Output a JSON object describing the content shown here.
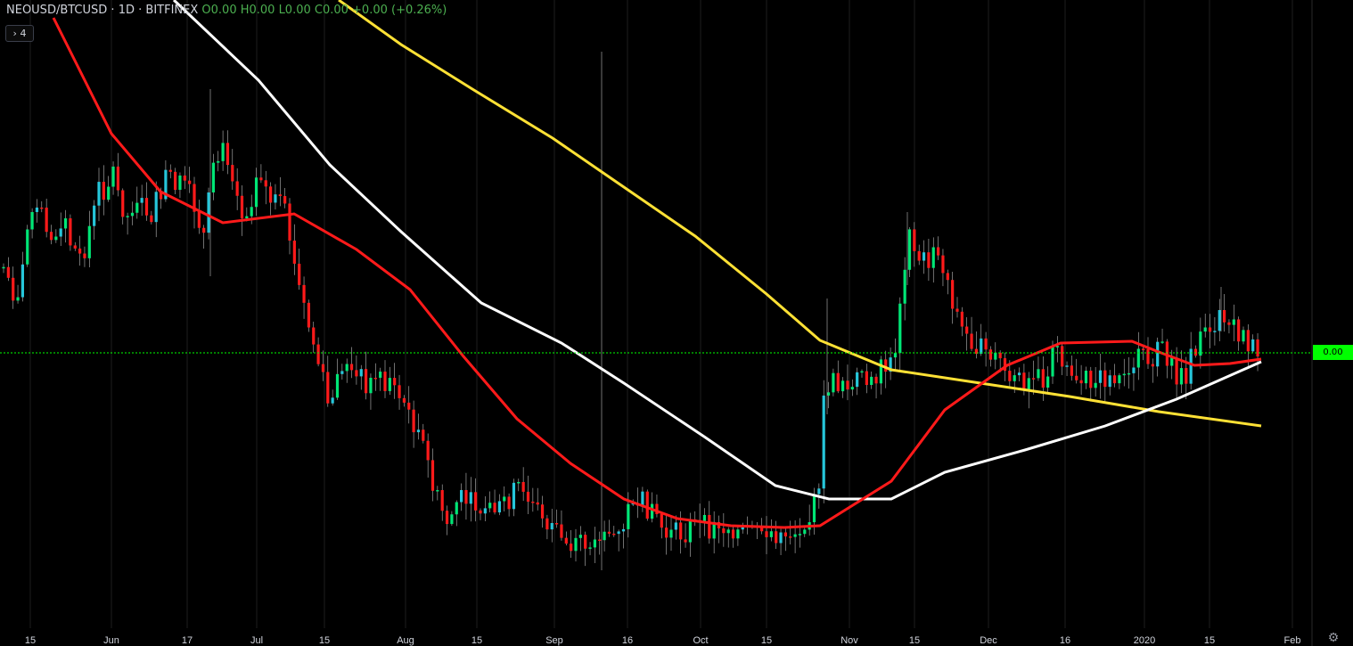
{
  "header": {
    "symbol": "NEOUSD/BTCUSD",
    "separator1": "·",
    "interval": "1D",
    "separator2": "·",
    "exchange": "BITFINEX",
    "ohlc": "O0.00  H0.00  L0.00  C0.00  +0.00 (+0.26%)"
  },
  "legend_toggle": "› 4",
  "price_tag": "0.00",
  "colors": {
    "up": "#00e676",
    "up_alt": "#26c6da",
    "down": "#ff1a1a",
    "ma_fast": "#ff1a1a",
    "ma_mid": "#ffffff",
    "ma_slow": "#ffe135",
    "price_line": "#00ff00",
    "grid": "#1e1e1e",
    "axis_text": "#d1d4dc"
  },
  "icons": {
    "settings": "gear-icon"
  },
  "chart_data": {
    "type": "candlestick",
    "x_axis_labels": [
      "15",
      "Jun",
      "17",
      "Jul",
      "15",
      "Aug",
      "15",
      "Sep",
      "16",
      "Oct",
      "15",
      "Nov",
      "15",
      "Dec",
      "16",
      "2020",
      "15",
      "Feb"
    ],
    "y_axis_labels": [],
    "current_price_label": "0.00",
    "moving_averages": [
      {
        "color": "#ff1a1a"
      },
      {
        "color": "#ffffff"
      },
      {
        "color": "#ffe135"
      }
    ]
  }
}
